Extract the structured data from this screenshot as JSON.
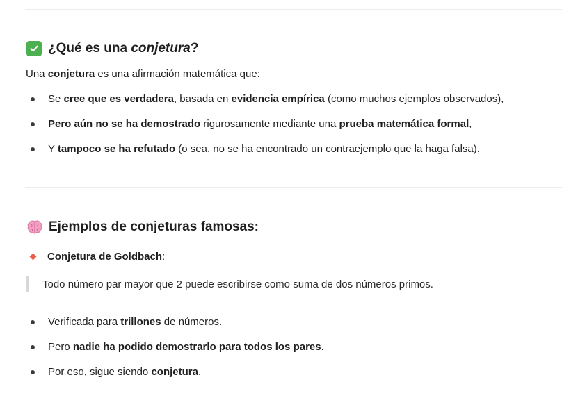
{
  "section1": {
    "icon": "check-mark-button-icon",
    "heading_pre": "¿Qué es una ",
    "heading_em": "conjetura",
    "heading_post": "?",
    "intro_a": "Una ",
    "intro_b": "conjetura",
    "intro_c": " es una afirmación matemática que:",
    "bullets": [
      [
        "Se ",
        "cree que es verdadera",
        ", basada en ",
        "evidencia empírica",
        " (como muchos ejemplos observados),"
      ],
      [
        "Pero aún no se ha demostrado",
        " rigurosamente mediante una ",
        "prueba matemática formal",
        ","
      ],
      [
        "Y ",
        "tampoco se ha refutado",
        " (o sea, no se ha encontrado un contraejemplo que la haga falsa)."
      ]
    ]
  },
  "section2": {
    "icon": "brain-icon",
    "heading": "Ejemplos de conjeturas famosas:",
    "item_title": "Conjetura de Goldbach",
    "item_colon": ":",
    "quote": "Todo número par mayor que 2 puede escribirse como suma de dos números primos.",
    "bullets": [
      [
        "Verificada para ",
        "trillones",
        " de números."
      ],
      [
        "Pero ",
        "nadie ha podido demostrarlo para todos los pares",
        "."
      ],
      [
        "Por eso, sigue siendo ",
        "conjetura",
        "."
      ]
    ]
  },
  "colors": {
    "accent_check": "#4caf50",
    "diamond": "#e8624a",
    "brain": "#f2a0c4"
  }
}
